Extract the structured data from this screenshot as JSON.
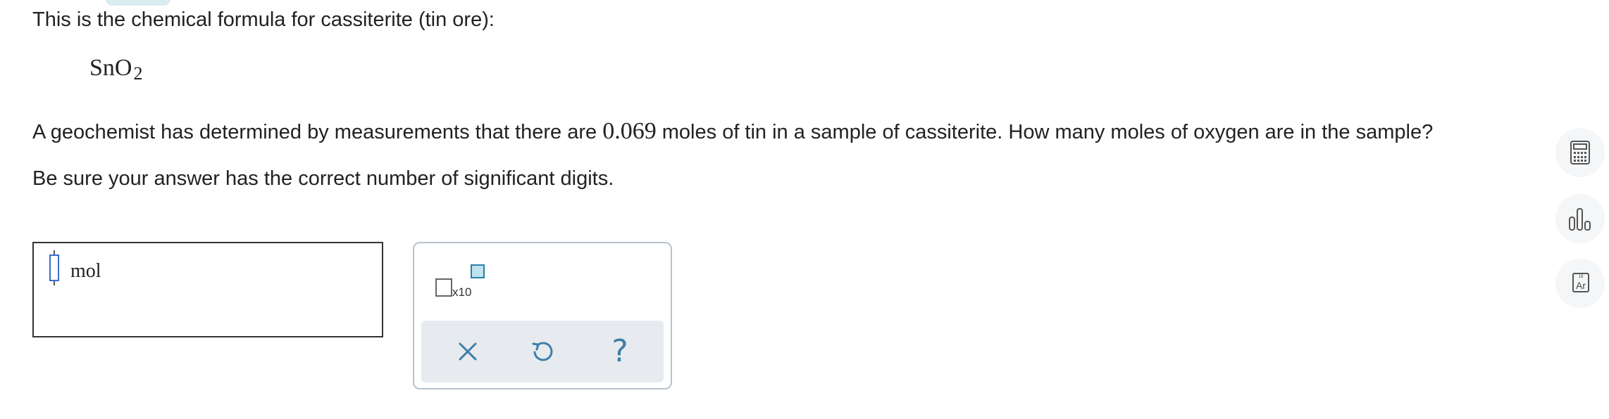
{
  "problem": {
    "intro": "This is the chemical formula for cassiterite (tin ore):",
    "formula_base": "SnO",
    "formula_subscript": "2",
    "question_before": "A geochemist has determined by measurements that there are ",
    "question_value": "0.069",
    "question_after": " moles of tin in a sample of cassiterite. How many moles of oxygen are in the sample?",
    "instruction": "Be sure your answer has the correct number of significant digits."
  },
  "answer": {
    "unit": "mol",
    "value": ""
  },
  "tools": {
    "sci_notation_label": "x10",
    "clear_icon": "close-icon",
    "undo_icon": "undo-icon",
    "help_symbol": "?"
  },
  "sidebar": {
    "calculator_icon": "calculator-icon",
    "chart_icon": "bar-chart-icon",
    "periodic_number": "18",
    "periodic_symbol": "Ar"
  },
  "colors": {
    "accent": "#3d7fa9",
    "slot_border": "#3b6ec8",
    "panel_border": "#b7c2cc"
  }
}
